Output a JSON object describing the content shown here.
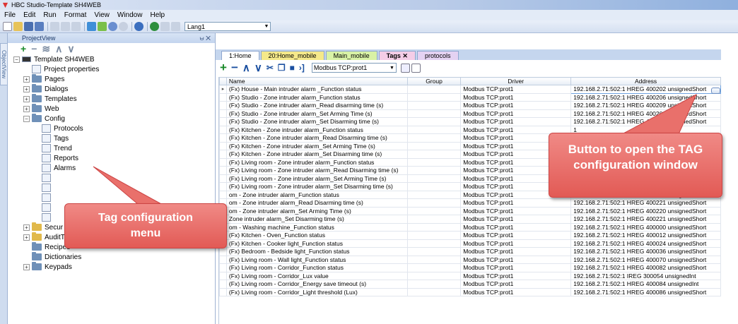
{
  "window": {
    "title": "HBC Studio-Template SH4WEB"
  },
  "menu": [
    "File",
    "Edit",
    "Run",
    "Format",
    "View",
    "Window",
    "Help"
  ],
  "toolbar": {
    "language_value": "Lang1"
  },
  "side_tab": {
    "label": "ObjectView"
  },
  "project_view": {
    "title": "ProjectView",
    "pin_close": "⩁ ✕",
    "tools": [
      "+",
      "−",
      "≋",
      "∧",
      "∨"
    ],
    "tree": [
      {
        "label": "Template SH4WEB",
        "level": 0,
        "exp": "−",
        "icon": "root"
      },
      {
        "label": "Project properties",
        "level": 1,
        "exp": "",
        "icon": "leaf"
      },
      {
        "label": "Pages",
        "level": 1,
        "exp": "+",
        "icon": "folder"
      },
      {
        "label": "Dialogs",
        "level": 1,
        "exp": "+",
        "icon": "folder"
      },
      {
        "label": "Templates",
        "level": 1,
        "exp": "+",
        "icon": "folder"
      },
      {
        "label": "Web",
        "level": 1,
        "exp": "+",
        "icon": "folder"
      },
      {
        "label": "Config",
        "level": 1,
        "exp": "−",
        "icon": "folder"
      },
      {
        "label": "Protocols",
        "level": 2,
        "exp": "",
        "icon": "leaf"
      },
      {
        "label": "Tags",
        "level": 2,
        "exp": "",
        "icon": "leaf"
      },
      {
        "label": "Trend",
        "level": 2,
        "exp": "",
        "icon": "leaf"
      },
      {
        "label": "Reports",
        "level": 2,
        "exp": "",
        "icon": "leaf"
      },
      {
        "label": "Alarms",
        "level": 2,
        "exp": "",
        "icon": "leaf"
      },
      {
        "label": "",
        "level": 2,
        "exp": "",
        "icon": "leaf"
      },
      {
        "label": "",
        "level": 2,
        "exp": "",
        "icon": "leaf"
      },
      {
        "label": "",
        "level": 2,
        "exp": "",
        "icon": "leaf"
      },
      {
        "label": "",
        "level": 2,
        "exp": "",
        "icon": "leaf"
      },
      {
        "label": "",
        "level": 2,
        "exp": "",
        "icon": "leaf"
      },
      {
        "label": "Secur",
        "level": 1,
        "exp": "+",
        "icon": "yfolder"
      },
      {
        "label": "AuditTrail",
        "level": 1,
        "exp": "+",
        "icon": "yfolder"
      },
      {
        "label": "Recipes",
        "level": 1,
        "exp": "",
        "icon": "folder"
      },
      {
        "label": "Dictionaries",
        "level": 1,
        "exp": "",
        "icon": "folder"
      },
      {
        "label": "Keypads",
        "level": 1,
        "exp": "+",
        "icon": "folder"
      }
    ]
  },
  "doc_tabs": [
    {
      "label": "1:Home",
      "style": "home"
    },
    {
      "label": "20:Home_mobile",
      "style": "yel"
    },
    {
      "label": "Main_mobile",
      "style": "grn"
    },
    {
      "label": "Tags  ✕",
      "style": "pink"
    },
    {
      "label": "protocols",
      "style": "purp"
    }
  ],
  "doc_toolbar": {
    "protocol_filter": "Modbus TCP:prot1"
  },
  "grid": {
    "headers": [
      "Name",
      "Group",
      "Driver",
      "Address"
    ],
    "rows": [
      [
        "(Fx) House - Main intruder alarm _Function status",
        "",
        "Modbus TCP:prot1",
        "192.168.2.71:502:1 HREG 400202 unsignedShort"
      ],
      [
        "(Fx) Studio - Zone intruder alarm_Function status",
        "",
        "Modbus TCP:prot1",
        "192.168.2.71:502:1 HREG 400206 unsignedShort"
      ],
      [
        "(Fx) Studio - Zone intruder alarm_Read disarming time (s)",
        "",
        "Modbus TCP:prot1",
        "192.168.2.71:502:1 HREG 400209 unsignedShort"
      ],
      [
        "(Fx) Studio - Zone intruder alarm_Set Arming Time (s)",
        "",
        "Modbus TCP:prot1",
        "192.168.2.71:502:1 HREG 400208 unsignedShort"
      ],
      [
        "(Fx) Studio - Zone intruder alarm_Set Disarming time (s)",
        "",
        "Modbus TCP:prot1",
        "192.168.2.71:502:1 HREG 400209 unsignedShort"
      ],
      [
        "(Fx) Kitchen - Zone intruder alarm_Function status",
        "",
        "Modbus TCP:prot1",
        "1"
      ],
      [
        "(Fx) Kitchen - Zone intruder alarm_Read Disarming time (s)",
        "",
        "Modbus TCP:prot1",
        "1"
      ],
      [
        "(Fx) Kitchen - Zone intruder alarm_Set Arming Time (s)",
        "",
        "Modbus TCP:prot1",
        "1"
      ],
      [
        "(Fx) Kitchen - Zone intruder alarm_Set Disarming time (s)",
        "",
        "Modbus TCP:prot1",
        "1"
      ],
      [
        "(Fx) Living room - Zone intruder alarm_Function status",
        "",
        "Modbus TCP:prot1",
        "1"
      ],
      [
        "(Fx) Living room - Zone intruder alarm_Read Disarming time (s)",
        "",
        "Modbus TCP:prot1",
        "1"
      ],
      [
        "(Fx) Living room - Zone intruder alarm_Set Arming Time (s)",
        "",
        "Modbus TCP:prot1",
        "1"
      ],
      [
        "(Fx) Living room - Zone intruder alarm_Set Disarming time (s)",
        "",
        "Modbus TCP:prot1",
        "192"
      ],
      [
        "om - Zone intruder alarm_Function status",
        "",
        "Modbus TCP:prot1",
        "192.168.2.71:502:1 HREG 400218 unsignedShort"
      ],
      [
        "om - Zone intruder alarm_Read Disarming time (s)",
        "",
        "Modbus TCP:prot1",
        "192.168.2.71:502:1 HREG 400221 unsignedShort"
      ],
      [
        "om - Zone intruder alarm_Set Arming Time (s)",
        "",
        "Modbus TCP:prot1",
        "192.168.2.71:502:1 HREG 400220 unsignedShort"
      ],
      [
        "Zone intruder alarm_Set Disarming time (s)",
        "",
        "Modbus TCP:prot1",
        "192.168.2.71:502:1 HREG 400221 unsignedShort"
      ],
      [
        "om - Washing machine_Function status",
        "",
        "Modbus TCP:prot1",
        "192.168.2.71:502:1 HREG 400000 unsignedShort"
      ],
      [
        "(Fx) Kitchen - Oven_Function status",
        "",
        "Modbus TCP:prot1",
        "192.168.2.71:502:1 HREG 400012 unsignedShort"
      ],
      [
        "(Fx) Kitchen - Cooker light_Function status",
        "",
        "Modbus TCP:prot1",
        "192.168.2.71:502:1 HREG 400024 unsignedShort"
      ],
      [
        "(Fx) Bedroom - Bedside light_Function status",
        "",
        "Modbus TCP:prot1",
        "192.168.2.71:502:1 HREG 400036 unsignedShort"
      ],
      [
        "(Fx) Living room - Wall light_Function status",
        "",
        "Modbus TCP:prot1",
        "192.168.2.71:502:1 HREG 400070 unsignedShort"
      ],
      [
        "(Fx) Living room - Corridor_Function status",
        "",
        "Modbus TCP:prot1",
        "192.168.2.71:502:1 HREG 400082 unsignedShort"
      ],
      [
        "(Fx) Living room - Corridor_Lux value",
        "",
        "Modbus TCP:prot1",
        "192.168.2.71:502:1 IREG 300054 unsignedInt"
      ],
      [
        "(Fx) Living room - Corridor_Energy save timeout (s)",
        "",
        "Modbus TCP:prot1",
        "192.168.2.71:502:1 HREG 400084 unsignedInt"
      ],
      [
        "(Fx) Living room - Corridor_Light threshold (Lux)",
        "",
        "Modbus TCP:prot1",
        "192.168.2.71:502:1 HREG 400086 unsignedShort"
      ]
    ]
  },
  "callouts": {
    "left": "Tag configuration menu",
    "right": "Button to open the TAG configuration window"
  }
}
